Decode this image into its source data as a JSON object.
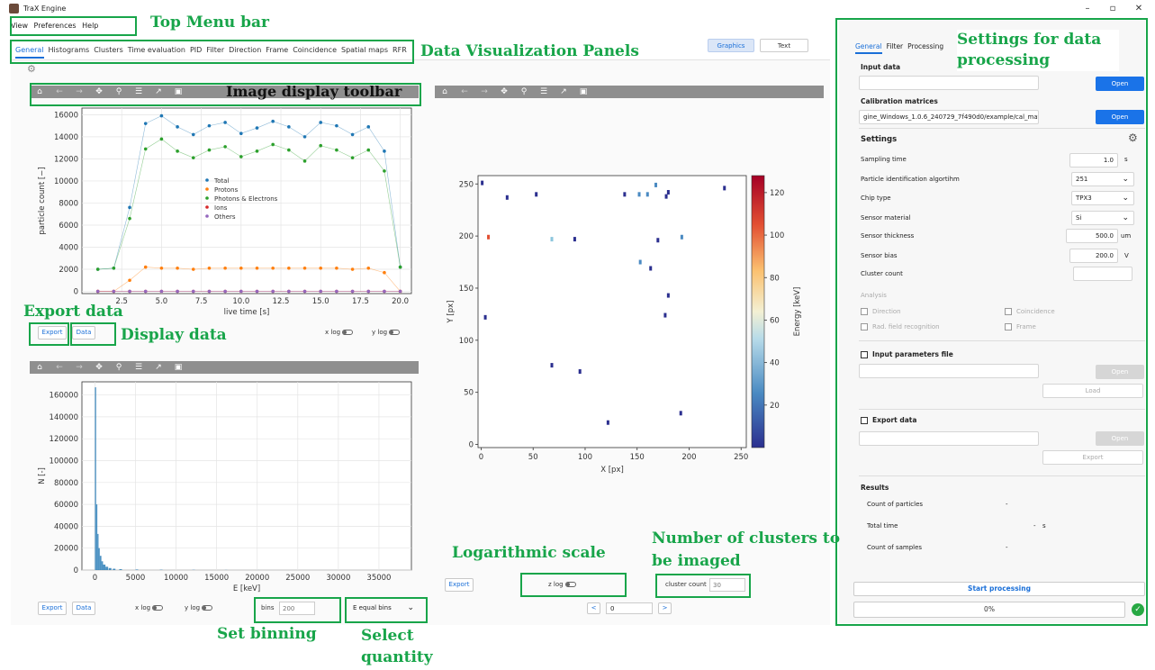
{
  "window": {
    "title": "TraX Engine",
    "minimize": "–",
    "maximize": "▫",
    "close": "✕"
  },
  "menu": [
    "View",
    "Preferences",
    "Help"
  ],
  "tabs": [
    "General",
    "Histograms",
    "Clusters",
    "Time evaluation",
    "PID",
    "Filter",
    "Direction",
    "Frame",
    "Coincidence",
    "Spatial maps",
    "RFR"
  ],
  "view_toggle": {
    "graphics": "Graphics",
    "text": "Text"
  },
  "toolbar_icons": [
    "home-icon",
    "back-arrow-icon",
    "forward-arrow-icon",
    "pan-icon",
    "zoom-icon",
    "configure-icon",
    "edit-axes-icon",
    "save-icon"
  ],
  "plot1": {
    "export_label": "Export",
    "data_label": "Data",
    "xlog_label": "x log",
    "ylog_label": "y log"
  },
  "plot2": {
    "export_label": "Export",
    "data_label": "Data",
    "xlog_label": "x log",
    "ylog_label": "y log",
    "bins_label": "bins",
    "bins_placeholder": "200",
    "bins_mode": "E equal bins"
  },
  "plot3": {
    "export_label": "Export",
    "zlog_label": "z log",
    "cluster_count_label": "cluster count",
    "cluster_count_placeholder": "30",
    "prev": "<",
    "next": ">",
    "index": "0"
  },
  "chart_data": [
    {
      "type": "line",
      "xlabel": "live time [s]",
      "ylabel": "particle count [−]",
      "xticks": [
        "2.5",
        "5.0",
        "7.5",
        "10.0",
        "12.5",
        "15.0",
        "17.5",
        "20.0"
      ],
      "yticks": [
        "0",
        "2000",
        "4000",
        "6000",
        "8000",
        "10000",
        "12000",
        "14000",
        "16000"
      ],
      "xlim": [
        0,
        20.7
      ],
      "ylim": [
        -200,
        16600
      ],
      "x": [
        1,
        2,
        3,
        4,
        5,
        6,
        7,
        8,
        9,
        10,
        11,
        12,
        13,
        14,
        15,
        16,
        17,
        18,
        19,
        20
      ],
      "series": [
        {
          "name": "Total",
          "color": "#1f77b4",
          "values": [
            2000,
            2100,
            7600,
            15200,
            15900,
            14900,
            14200,
            15000,
            15300,
            14300,
            14800,
            15400,
            14900,
            14000,
            15300,
            15000,
            14200,
            14900,
            12700,
            2200
          ]
        },
        {
          "name": "Protons",
          "color": "#ff7f0e",
          "values": [
            0,
            0,
            1000,
            2200,
            2100,
            2100,
            2000,
            2100,
            2100,
            2100,
            2100,
            2100,
            2100,
            2100,
            2100,
            2100,
            2000,
            2100,
            1700,
            0
          ]
        },
        {
          "name": "Photons & Electrons",
          "color": "#2ca02c",
          "values": [
            2000,
            2100,
            6600,
            12900,
            13800,
            12700,
            12100,
            12800,
            13100,
            12200,
            12700,
            13300,
            12800,
            11800,
            13200,
            12800,
            12100,
            12800,
            10900,
            2200
          ]
        },
        {
          "name": "Ions",
          "color": "#d62728",
          "values": [
            0,
            0,
            0,
            0,
            0,
            0,
            0,
            0,
            0,
            0,
            0,
            0,
            0,
            0,
            0,
            0,
            0,
            0,
            0,
            0
          ]
        },
        {
          "name": "Others",
          "color": "#9467bd",
          "values": [
            0,
            0,
            0,
            0,
            0,
            0,
            0,
            0,
            0,
            0,
            0,
            0,
            0,
            0,
            0,
            0,
            0,
            0,
            0,
            0
          ]
        }
      ],
      "legend": "center"
    },
    {
      "type": "bar",
      "xlabel": "E [keV]",
      "ylabel": "N [-]",
      "xticks": [
        "0",
        "5000",
        "10000",
        "15000",
        "20000",
        "25000",
        "30000",
        "35000"
      ],
      "yticks": [
        "0",
        "20000",
        "40000",
        "60000",
        "80000",
        "100000",
        "120000",
        "140000",
        "160000"
      ],
      "xlim": [
        -1600,
        39000
      ],
      "ylim": [
        0,
        172000
      ],
      "color": "#1f77b4",
      "x": [
        0,
        150,
        300,
        450,
        600,
        800,
        1000,
        1300,
        1700,
        2200,
        3000,
        5000,
        8000,
        12000,
        16000,
        20000
      ],
      "values": [
        167000,
        60000,
        33000,
        20000,
        13000,
        8000,
        5000,
        3000,
        1800,
        1200,
        800,
        500,
        300,
        200,
        100,
        50
      ]
    },
    {
      "type": "scatter",
      "xlabel": "X [px]",
      "ylabel": "Y [px]",
      "xticks": [
        "0",
        "50",
        "100",
        "150",
        "200",
        "250"
      ],
      "yticks": [
        "0",
        "50",
        "100",
        "150",
        "200",
        "250"
      ],
      "colorbar_label": "Energy [keV]",
      "colorbar_ticks": [
        "20",
        "40",
        "60",
        "80",
        "100",
        "120"
      ],
      "xlim": [
        -3,
        255
      ],
      "ylim": [
        -3,
        258
      ],
      "points": [
        {
          "x": 1,
          "y": 251,
          "e": 20
        },
        {
          "x": 25,
          "y": 237,
          "e": 15
        },
        {
          "x": 53,
          "y": 240,
          "e": 18
        },
        {
          "x": 7,
          "y": 199,
          "e": 110
        },
        {
          "x": 68,
          "y": 197,
          "e": 70
        },
        {
          "x": 90,
          "y": 197,
          "e": 15
        },
        {
          "x": 138,
          "y": 240,
          "e": 18
        },
        {
          "x": 152,
          "y": 240,
          "e": 35
        },
        {
          "x": 160,
          "y": 240,
          "e": 30
        },
        {
          "x": 168,
          "y": 249,
          "e": 45
        },
        {
          "x": 178,
          "y": 238,
          "e": 25
        },
        {
          "x": 180,
          "y": 242,
          "e": 20
        },
        {
          "x": 170,
          "y": 196,
          "e": 20
        },
        {
          "x": 153,
          "y": 175,
          "e": 35
        },
        {
          "x": 163,
          "y": 169,
          "e": 25
        },
        {
          "x": 193,
          "y": 199,
          "e": 40
        },
        {
          "x": 234,
          "y": 246,
          "e": 20
        },
        {
          "x": 180,
          "y": 143,
          "e": 25
        },
        {
          "x": 177,
          "y": 124,
          "e": 25
        },
        {
          "x": 4,
          "y": 122,
          "e": 15
        },
        {
          "x": 68,
          "y": 76,
          "e": 22
        },
        {
          "x": 95,
          "y": 70,
          "e": 25
        },
        {
          "x": 122,
          "y": 21,
          "e": 18
        },
        {
          "x": 192,
          "y": 30,
          "e": 15
        }
      ]
    }
  ],
  "settings": {
    "tabs": [
      "General",
      "Filter",
      "Processing"
    ],
    "input_data": {
      "header": "Input data",
      "value": "",
      "button": "Open"
    },
    "calibration": {
      "header": "Calibration matrices",
      "value": "gine_Windows_1.0.6_240729_7f490d0/example/cal_mat",
      "button": "Open"
    },
    "settings_header": "Settings",
    "sampling_time": {
      "label": "Sampling time",
      "value": "1.0",
      "unit": "s"
    },
    "pid_algorithm": {
      "label": "Particle identification algortihm",
      "value": "251"
    },
    "chip_type": {
      "label": "Chip type",
      "value": "TPX3"
    },
    "sensor_material": {
      "label": "Sensor material",
      "value": "Si"
    },
    "sensor_thickness": {
      "label": "Sensor thickness",
      "value": "500.0",
      "unit": "um"
    },
    "sensor_bias": {
      "label": "Sensor bias",
      "value": "200.0",
      "unit": "V"
    },
    "cluster_count": {
      "label": "Cluster count",
      "value": ""
    },
    "analysis": {
      "label": "Analysis",
      "direction": "Direction",
      "coincidence": "Coincidence",
      "rfr": "Rad. field recognition",
      "frame": "Frame"
    },
    "input_params": {
      "label": "Input parameters file",
      "open": "Open",
      "load": "Load"
    },
    "export_data": {
      "label": "Export data",
      "open": "Open",
      "export": "Export"
    },
    "results": {
      "header": "Results",
      "count_particles": "Count of particles",
      "count_particles_value": "-",
      "total_time": "Total time",
      "total_time_value": "-",
      "total_time_unit": "s",
      "count_samples": "Count of samples",
      "count_samples_value": "-"
    },
    "start_button": "Start processing",
    "progress": {
      "text": "0%",
      "fraction": 0
    }
  },
  "annotations": {
    "top_menu": "Top Menu bar",
    "panels": "Data Visualization Panels",
    "settings": "Settings for data processing",
    "toolbar": "Image display toolbar",
    "export": "Export data",
    "display": "Display data",
    "log": "Logarithmic scale",
    "clusters": "Number of clusters to be imaged",
    "binning": "Set binning",
    "quantity": "Select quantity"
  }
}
